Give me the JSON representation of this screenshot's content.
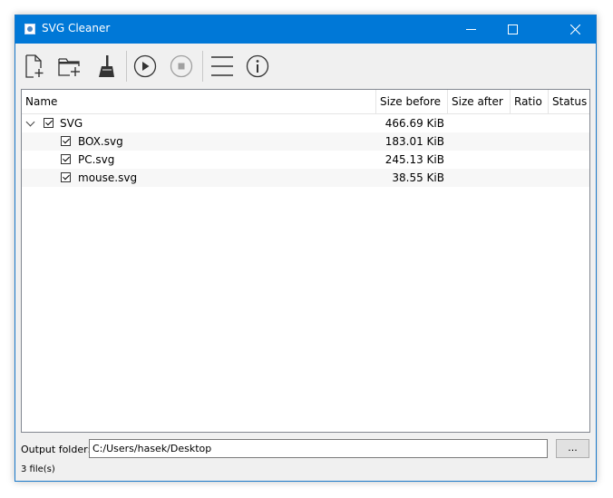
{
  "window": {
    "title": "SVG Cleaner",
    "controls": {
      "minimize": "─",
      "maximize": "☐",
      "close": "✕"
    }
  },
  "toolbar": {
    "buttons": [
      {
        "name": "add-file",
        "icon": "add-file-icon"
      },
      {
        "name": "add-folder",
        "icon": "add-folder-icon"
      },
      {
        "name": "clear",
        "icon": "broom-icon"
      },
      {
        "name": "start",
        "icon": "play-icon"
      },
      {
        "name": "stop",
        "icon": "stop-icon",
        "disabled": true
      },
      {
        "name": "menu",
        "icon": "hamburger-icon"
      },
      {
        "name": "about",
        "icon": "info-icon"
      }
    ]
  },
  "tree": {
    "columns": [
      "Name",
      "Size before",
      "Size after",
      "Ratio",
      "Status"
    ],
    "root": {
      "name": "SVG",
      "size_before": "466.69 KiB",
      "checked": true,
      "expanded": true
    },
    "files": [
      {
        "name": "BOX.svg",
        "size_before": "183.01 KiB",
        "checked": true
      },
      {
        "name": "PC.svg",
        "size_before": "245.13 KiB",
        "checked": true
      },
      {
        "name": "mouse.svg",
        "size_before": "38.55 KiB",
        "checked": true
      }
    ]
  },
  "output": {
    "label": "Output folder:",
    "path": "C:/Users/hasek/Desktop",
    "browse_label": "..."
  },
  "status": {
    "file_count": "3 file(s)"
  },
  "colors": {
    "titlebar": "#0078d7",
    "window_bg": "#f0f0f0"
  }
}
